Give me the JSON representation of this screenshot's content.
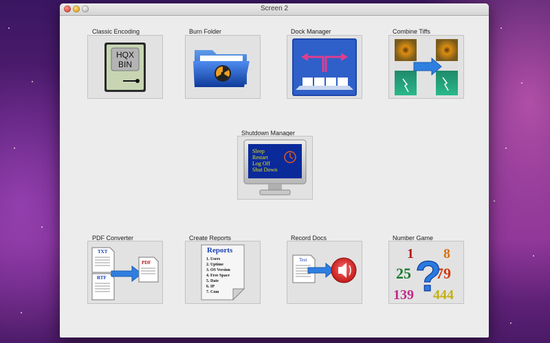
{
  "window": {
    "title": "Screen 2"
  },
  "apps": {
    "classic_encoding": {
      "label": "Classic Encoding",
      "icon": "hqx-bin-icon",
      "icon_text": [
        "HQX",
        "BIN"
      ]
    },
    "burn_folder": {
      "label": "Burn Folder",
      "icon": "burn-folder-icon"
    },
    "dock_manager": {
      "label": "Dock Manager",
      "icon": "dock-manager-icon"
    },
    "combine_tiffs": {
      "label": "Combine Tiffs",
      "icon": "combine-tiffs-icon"
    },
    "shutdown_manager": {
      "label": "Shutdown Manager",
      "icon": "monitor-shutdown-icon",
      "icon_text": [
        "Sleep",
        "Restart",
        "Log Off",
        "Shut Down"
      ]
    },
    "pdf_converter": {
      "label": "PDF Converter",
      "icon": "pdf-converter-icon",
      "icon_text": [
        "TXT",
        "RTF",
        "PDF"
      ]
    },
    "create_reports": {
      "label": "Create Reports",
      "icon": "reports-document-icon",
      "icon_title": "Reports",
      "icon_items": [
        "1. Users",
        "2. Uptime",
        "3. OS Version",
        "4. Free Space",
        "5. Date",
        "6. IP",
        "7. Com"
      ]
    },
    "record_docs": {
      "label": "Record Docs",
      "icon": "record-docs-icon",
      "icon_text": [
        "Test"
      ]
    },
    "number_game": {
      "label": "Number Game",
      "icon": "number-game-icon",
      "icon_numbers": [
        "1",
        "8",
        "25",
        "79",
        "139",
        "444"
      ],
      "icon_symbol": "?"
    }
  },
  "colors": {
    "window_bg": "#ececec",
    "tile_bg": "#e2e2e2",
    "close": "#e0443a",
    "minimize": "#e0a020",
    "zoom": "#bdbdbd"
  }
}
